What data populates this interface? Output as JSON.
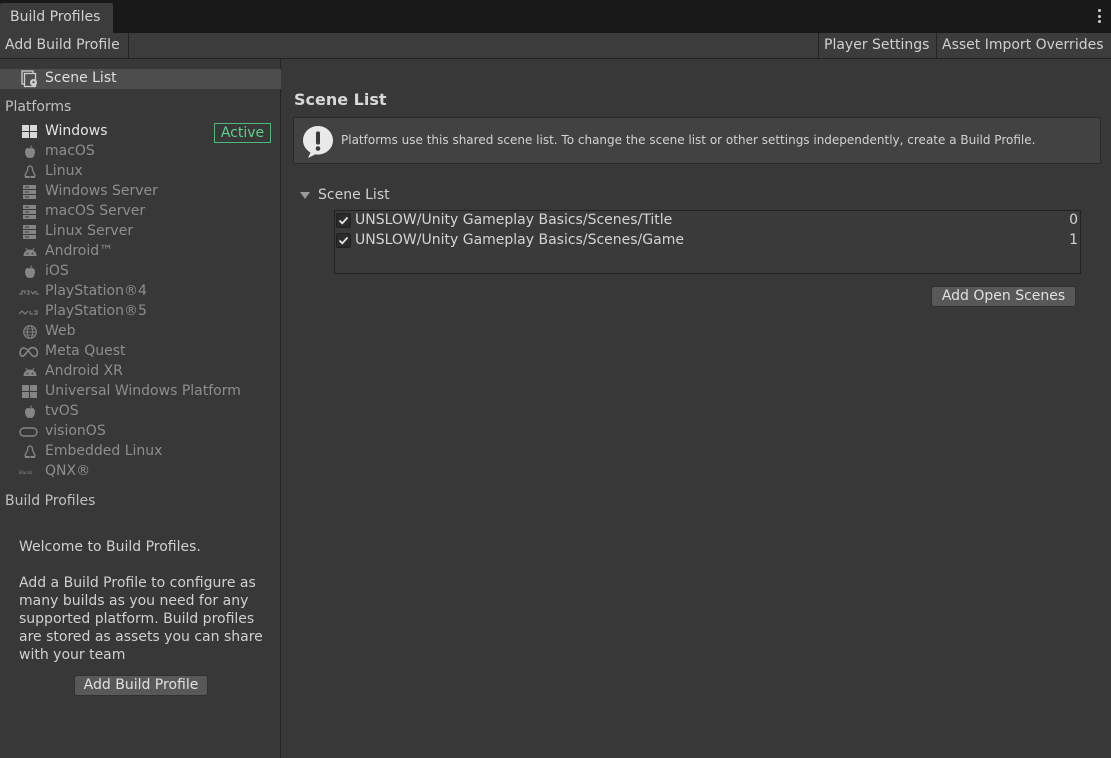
{
  "window": {
    "tab_title": "Build Profiles"
  },
  "toolbar": {
    "add_build_profile": "Add Build Profile",
    "player_settings": "Player Settings",
    "asset_import_overrides": "Asset Import Overrides"
  },
  "sidebar": {
    "scene_list_label": "Scene List",
    "platforms_title": "Platforms",
    "active_label": "Active",
    "platforms": [
      {
        "label": "Windows",
        "icon": "windows-icon"
      },
      {
        "label": "macOS",
        "icon": "apple-icon"
      },
      {
        "label": "Linux",
        "icon": "linux-icon"
      },
      {
        "label": "Windows Server",
        "icon": "server-icon"
      },
      {
        "label": "macOS Server",
        "icon": "server-icon"
      },
      {
        "label": "Linux Server",
        "icon": "server-icon"
      },
      {
        "label": "Android™",
        "icon": "android-icon"
      },
      {
        "label": "iOS",
        "icon": "apple-icon"
      },
      {
        "label": "PlayStation®4",
        "icon": "ps4-icon"
      },
      {
        "label": "PlayStation®5",
        "icon": "ps5-icon"
      },
      {
        "label": "Web",
        "icon": "globe-icon"
      },
      {
        "label": "Meta Quest",
        "icon": "meta-icon"
      },
      {
        "label": "Android XR",
        "icon": "android-icon"
      },
      {
        "label": "Universal Windows Platform",
        "icon": "windows-icon"
      },
      {
        "label": "tvOS",
        "icon": "apple-icon"
      },
      {
        "label": "visionOS",
        "icon": "vision-icon"
      },
      {
        "label": "Embedded Linux",
        "icon": "linux-icon"
      },
      {
        "label": "QNX®",
        "icon": "qnx-icon"
      }
    ],
    "build_profiles_title": "Build Profiles",
    "welcome_heading": "Welcome to Build Profiles.",
    "welcome_body": "Add a Build Profile to configure as many builds as you need for any supported platform. Build profiles are stored as assets you can share with your team",
    "add_build_profile_button": "Add Build Profile"
  },
  "main": {
    "title": "Scene List",
    "info_text": "Platforms use this shared scene list. To change the scene list or other settings independently, create a Build Profile.",
    "foldout_label": "Scene List",
    "scenes": [
      {
        "path": "UNSLOW/Unity Gameplay Basics/Scenes/Title",
        "index": "0",
        "checked": true
      },
      {
        "path": "UNSLOW/Unity Gameplay Basics/Scenes/Game",
        "index": "1",
        "checked": true
      }
    ],
    "add_open_scenes_button": "Add Open Scenes"
  }
}
